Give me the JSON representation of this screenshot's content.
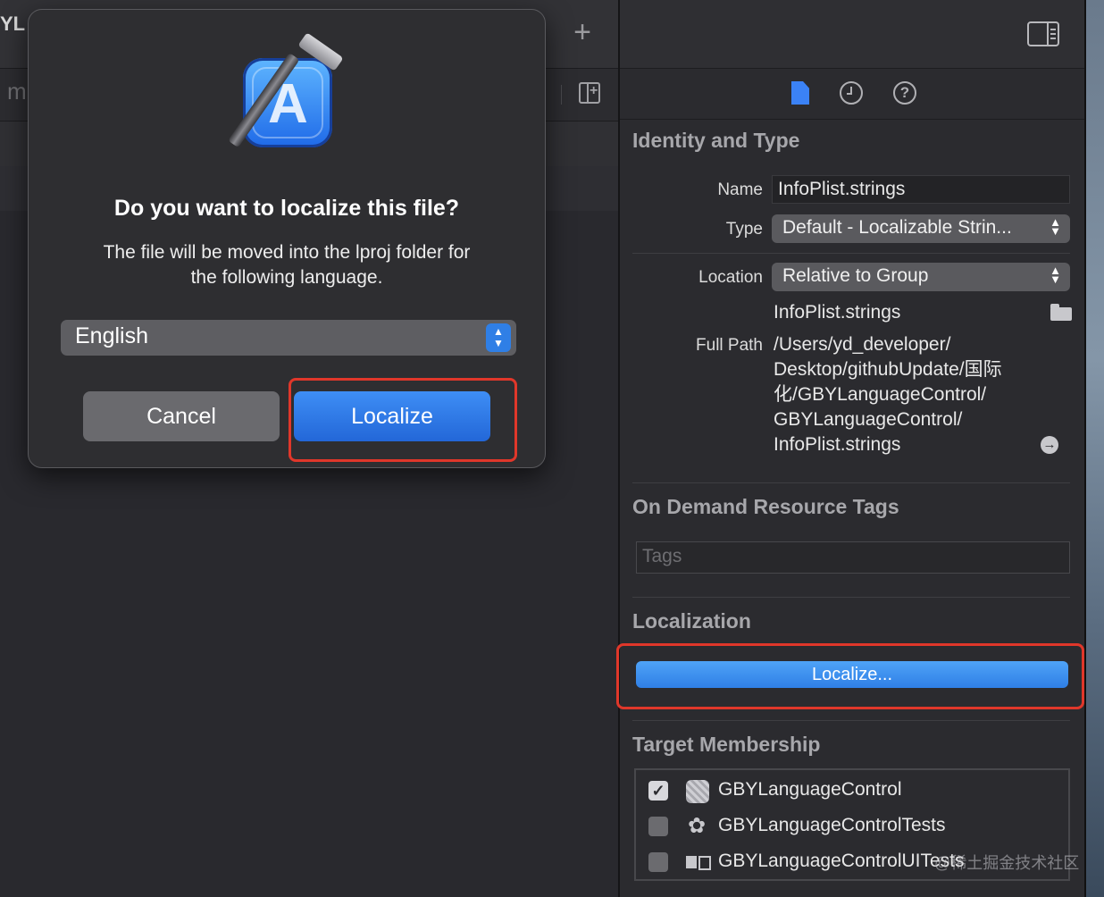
{
  "editor": {
    "tab_fragment": "YL",
    "jump_fragment": "m",
    "add_tab_symbol": "+"
  },
  "inspector": {
    "tabs": [
      "file-inspector",
      "history-inspector",
      "quick-help"
    ],
    "identity": {
      "title": "Identity and Type",
      "name_label": "Name",
      "name_value": "InfoPlist.strings",
      "type_label": "Type",
      "type_value": "Default - Localizable Strin...",
      "location_label": "Location",
      "location_value": "Relative to Group",
      "location_filename": "InfoPlist.strings",
      "full_path_label": "Full Path",
      "full_path_lines": [
        "/Users/yd_developer/",
        "Desktop/githubUpdate/国际",
        "化/GBYLanguageControl/",
        "GBYLanguageControl/",
        "InfoPlist.strings"
      ]
    },
    "on_demand": {
      "title": "On Demand Resource Tags",
      "tags_placeholder": "Tags"
    },
    "localization": {
      "title": "Localization",
      "button_label": "Localize..."
    },
    "target_membership": {
      "title": "Target Membership",
      "targets": [
        {
          "name": "GBYLanguageControl",
          "checked": true,
          "icon": "app-target-icon"
        },
        {
          "name": "GBYLanguageControlTests",
          "checked": false,
          "icon": "test-target-icon"
        },
        {
          "name": "GBYLanguageControlUITests",
          "checked": false,
          "icon": "uitest-target-icon"
        }
      ]
    },
    "watermark": "@稀土掘金技术社区"
  },
  "dialog": {
    "title": "Do you want to localize this file?",
    "message_line1": "The file will be moved into the lproj folder for",
    "message_line2": "the following language.",
    "language_value": "English",
    "cancel_label": "Cancel",
    "localize_label": "Localize"
  },
  "colors": {
    "accent_blue": "#2f7fe6",
    "highlight_red": "#e0372a",
    "background": "#2b2b2f"
  }
}
